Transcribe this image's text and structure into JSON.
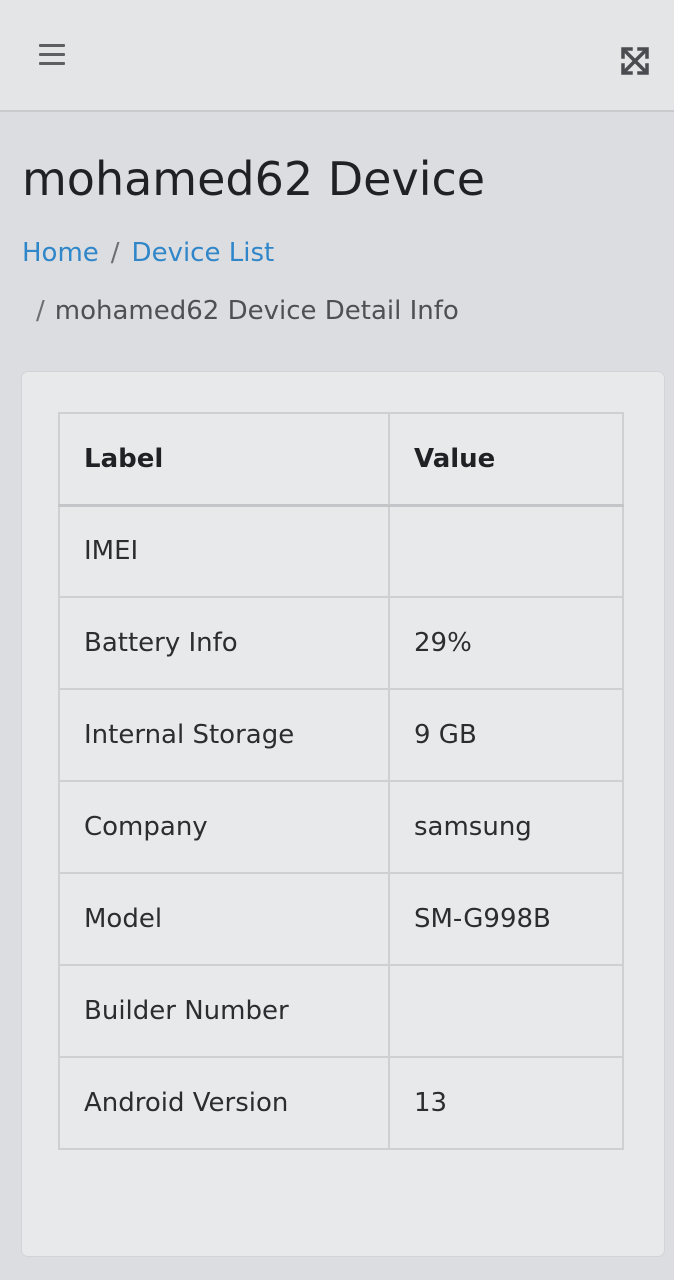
{
  "header": {
    "menu_icon": "hamburger-menu-icon",
    "fullscreen_icon": "expand-fullscreen-icon"
  },
  "page": {
    "title": "mohamed62 Device"
  },
  "breadcrumb": {
    "items": [
      "Home",
      "Device List",
      "mohamed62 Device Detail Info"
    ],
    "separator": "/"
  },
  "table": {
    "headers": {
      "label": "Label",
      "value": "Value"
    },
    "rows": [
      {
        "label": "IMEI",
        "value": ""
      },
      {
        "label": "Battery Info",
        "value": "29%"
      },
      {
        "label": "Internal Storage",
        "value": "9 GB"
      },
      {
        "label": "Company",
        "value": "samsung"
      },
      {
        "label": "Model",
        "value": "SM-G998B"
      },
      {
        "label": "Builder Number",
        "value": ""
      },
      {
        "label": "Android Version",
        "value": "13"
      }
    ]
  }
}
